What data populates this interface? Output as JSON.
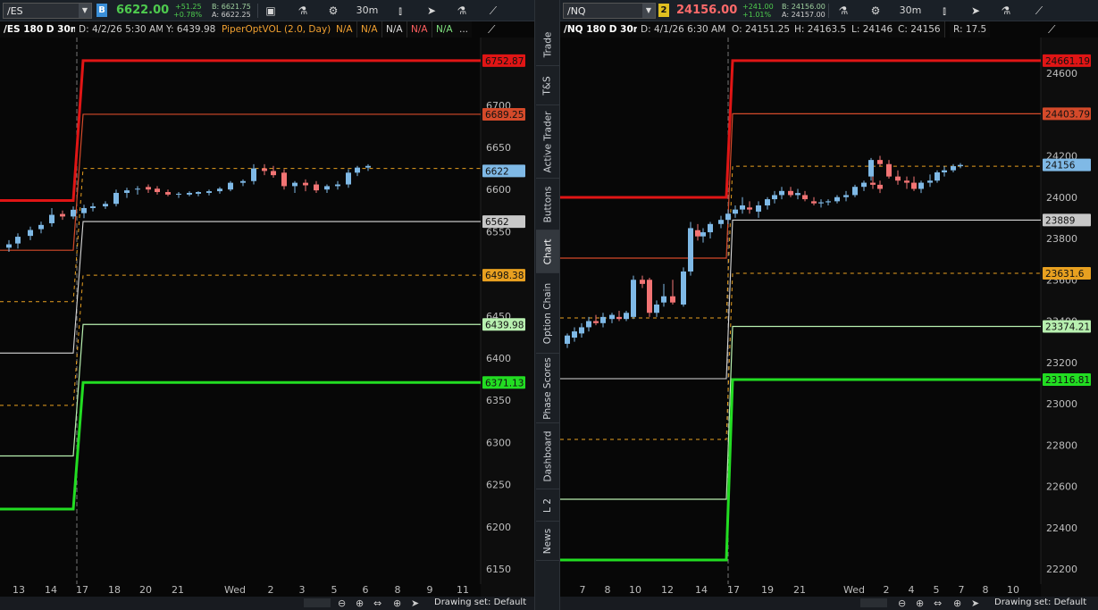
{
  "colors": {
    "red_thick": "#e01515",
    "red_thin": "#d44a2a",
    "orange_dash": "#e8a020",
    "white_line": "#d8d8d8",
    "lightgreen_line": "#b8f0b0",
    "green_thick": "#22dd22",
    "candle_up": "#7fb9e6",
    "candle_down": "#f27474",
    "positive": "#4ecb4e"
  },
  "side_tabs": [
    "Trade",
    "T&S",
    "Active Trader",
    "Buttons",
    "Chart",
    "Option Chain",
    "Phase Scores",
    "Dashboard",
    "L 2",
    "News"
  ],
  "active_side_tab": "Chart",
  "left": {
    "symbol": "/ES",
    "link_badge": "B",
    "last": "6622.00",
    "change": "+51.25",
    "change_pct": "+0.78%",
    "bid": "B: 6621.75",
    "ask": "A: 6622.25",
    "timeframe": "30m",
    "chart_title": "/ES 180 D 30m",
    "info_date": "D: 4/2/26 5:30 AM",
    "info_y": "Y: 6439.98",
    "study": "PiperOptVOL (2.0, Day)",
    "na_values": [
      "N/A",
      "N/A",
      "N/A",
      "N/A",
      "N/A"
    ],
    "more": "...",
    "price_ticks": [
      "6700",
      "6650",
      "6600",
      "6550",
      "6450",
      "6400",
      "6350",
      "6300",
      "6250",
      "6200",
      "6150"
    ],
    "level_labels": [
      "6752.87",
      "6689.25",
      "6622",
      "6562",
      "6498.38",
      "6439.98",
      "6371.13"
    ],
    "time_ticks": [
      "13",
      "14",
      "17",
      "18",
      "20",
      "21",
      "Wed",
      "2",
      "3",
      "5",
      "6",
      "8",
      "9",
      "11"
    ],
    "drawing_set": "Drawing set: Default"
  },
  "right": {
    "symbol": "/NQ",
    "link_badge": "2",
    "last": "24156.00",
    "change": "+241.00",
    "change_pct": "+1.01%",
    "bid": "B: 24156.00",
    "ask": "A: 24157.00",
    "timeframe": "30m",
    "chart_title": "/NQ 180 D 30m",
    "info_date": "D: 4/1/26 6:30 AM",
    "info_o": "O: 24151.25",
    "info_h": "H: 24163.5",
    "info_l": "L: 24146",
    "info_c": "C: 24156",
    "info_r": "R: 17.5",
    "price_ticks": [
      "24600",
      "24400",
      "24200",
      "24000",
      "23800",
      "23600",
      "23400",
      "23200",
      "23000",
      "22800",
      "22600",
      "22400",
      "22200"
    ],
    "level_labels": [
      "24661.19",
      "24403.79",
      "24156",
      "23889",
      "23631.6",
      "23374.21",
      "23116.81"
    ],
    "time_ticks": [
      "7",
      "8",
      "10",
      "12",
      "14",
      "17",
      "19",
      "21",
      "Wed",
      "2",
      "4",
      "5",
      "7",
      "8",
      "10"
    ],
    "drawing_set": "Drawing set: Default"
  },
  "icons": {
    "toolbar": [
      "study-icon",
      "gear-icon",
      "candle-style-icon",
      "cursor-icon",
      "flask-icon",
      "drawing-icon"
    ],
    "bottom": [
      "zoom-out-icon",
      "zoom-in-icon",
      "pan-icon",
      "crosshair-icon",
      "cursor-icon"
    ]
  }
}
